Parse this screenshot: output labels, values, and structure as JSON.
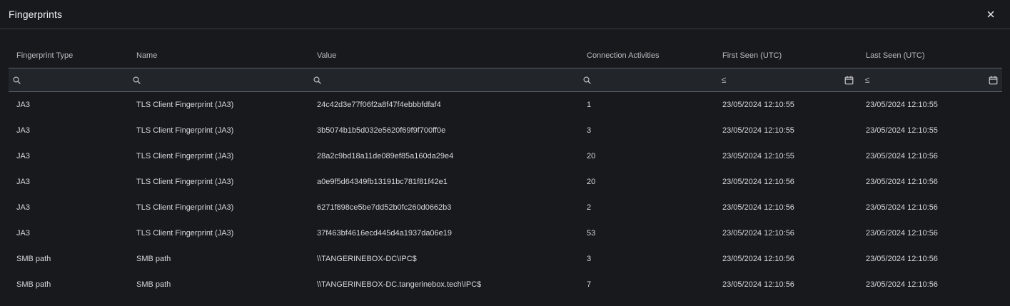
{
  "dialog": {
    "title": "Fingerprints",
    "close_label": "×"
  },
  "table": {
    "columns": [
      "Fingerprint Type",
      "Name",
      "Value",
      "Connection Activities",
      "First Seen (UTC)",
      "Last Seen (UTC)"
    ],
    "filters": {
      "fingerprint_type": "",
      "name": "",
      "value": "",
      "connection_activities": "",
      "first_seen_operator": "≤",
      "first_seen": "",
      "last_seen_operator": "≤",
      "last_seen": ""
    },
    "rows": [
      {
        "type": "JA3",
        "name": "TLS Client Fingerprint (JA3)",
        "value": "24c42d3e77f06f2a8f47f4ebbbfdfaf4",
        "activities": "1",
        "first_seen": "23/05/2024 12:10:55",
        "last_seen": "23/05/2024 12:10:55"
      },
      {
        "type": "JA3",
        "name": "TLS Client Fingerprint (JA3)",
        "value": "3b5074b1b5d032e5620f69f9f700ff0e",
        "activities": "3",
        "first_seen": "23/05/2024 12:10:55",
        "last_seen": "23/05/2024 12:10:55"
      },
      {
        "type": "JA3",
        "name": "TLS Client Fingerprint (JA3)",
        "value": "28a2c9bd18a11de089ef85a160da29e4",
        "activities": "20",
        "first_seen": "23/05/2024 12:10:55",
        "last_seen": "23/05/2024 12:10:56"
      },
      {
        "type": "JA3",
        "name": "TLS Client Fingerprint (JA3)",
        "value": "a0e9f5d64349fb13191bc781f81f42e1",
        "activities": "20",
        "first_seen": "23/05/2024 12:10:56",
        "last_seen": "23/05/2024 12:10:56"
      },
      {
        "type": "JA3",
        "name": "TLS Client Fingerprint (JA3)",
        "value": "6271f898ce5be7dd52b0fc260d0662b3",
        "activities": "2",
        "first_seen": "23/05/2024 12:10:56",
        "last_seen": "23/05/2024 12:10:56"
      },
      {
        "type": "JA3",
        "name": "TLS Client Fingerprint (JA3)",
        "value": "37f463bf4616ecd445d4a1937da06e19",
        "activities": "53",
        "first_seen": "23/05/2024 12:10:56",
        "last_seen": "23/05/2024 12:10:56"
      },
      {
        "type": "SMB path",
        "name": "SMB path",
        "value": "\\\\TANGERINEBOX-DC\\IPC$",
        "activities": "3",
        "first_seen": "23/05/2024 12:10:56",
        "last_seen": "23/05/2024 12:10:56"
      },
      {
        "type": "SMB path",
        "name": "SMB path",
        "value": "\\\\TANGERINEBOX-DC.tangerinebox.tech\\IPC$",
        "activities": "7",
        "first_seen": "23/05/2024 12:10:56",
        "last_seen": "23/05/2024 12:10:56"
      }
    ]
  },
  "icons": {
    "search": "search-icon",
    "calendar": "calendar-icon",
    "close": "close-icon"
  },
  "colors": {
    "background": "#17191d",
    "filter_background": "#22252a",
    "text": "#d6d8dc",
    "divider": "#5b5f67"
  }
}
